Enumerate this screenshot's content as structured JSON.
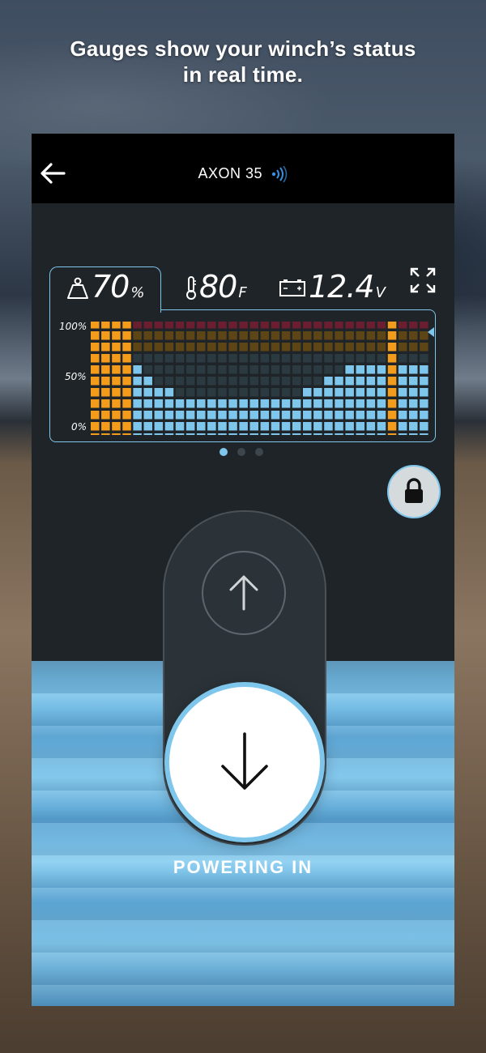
{
  "caption": {
    "line1": "Gauges show your winch’s status",
    "line2": "in real time."
  },
  "nav": {
    "back_icon": "back-arrow-icon",
    "title": "AXON 35",
    "connection_icon": "bluetooth-signal-icon"
  },
  "gauges": {
    "load": {
      "value": "70",
      "unit": "%",
      "icon": "weight-icon"
    },
    "temperature": {
      "value": "80",
      "unit": "F",
      "icon": "thermometer-icon"
    },
    "voltage": {
      "value": "12.4",
      "unit": "V",
      "icon": "battery-icon"
    },
    "expand_icon": "expand-icon"
  },
  "graph": {
    "axis_labels": {
      "top": "100%",
      "mid": "50%",
      "bottom": "0%"
    },
    "columns": [
      12,
      12,
      12,
      12,
      8,
      7,
      6,
      6,
      5,
      5,
      5,
      5,
      5,
      5,
      5,
      5,
      5,
      5,
      5,
      5,
      6,
      6,
      7,
      7,
      8,
      8,
      8,
      8,
      12,
      8,
      8,
      8
    ],
    "highlight_columns": [
      0,
      1,
      2,
      3,
      28
    ],
    "colors": {
      "highlight": "#f39c1b",
      "normal": "#7fc6ec",
      "empty": "#2b3940",
      "warn_band": "#5e4516",
      "top_band": "#6a1e30"
    }
  },
  "pager": {
    "count": 3,
    "active": 0
  },
  "lock": {
    "icon": "lock-icon"
  },
  "controls": {
    "up_icon": "arrow-up-icon",
    "down_icon": "arrow-down-icon",
    "status": "POWERING IN"
  },
  "colors": {
    "accent": "#7fc6ec",
    "panel": "#1e2428",
    "nav": "#000000"
  }
}
